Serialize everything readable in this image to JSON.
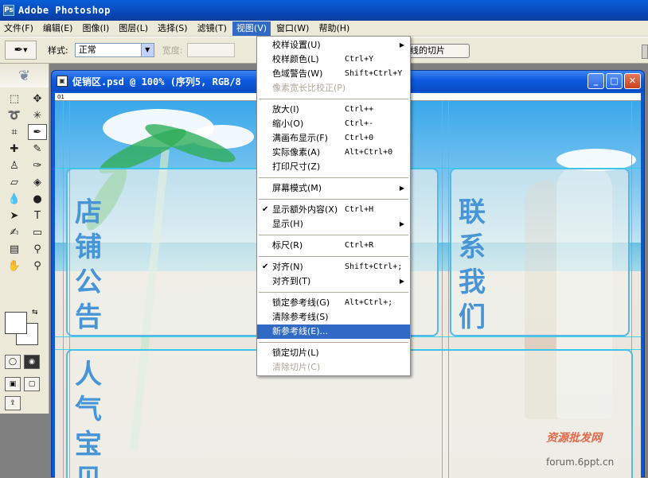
{
  "app": {
    "title": "Adobe Photoshop"
  },
  "menubar": [
    {
      "label": "文件(F)"
    },
    {
      "label": "编辑(E)"
    },
    {
      "label": "图像(I)"
    },
    {
      "label": "图层(L)"
    },
    {
      "label": "选择(S)"
    },
    {
      "label": "滤镜(T)"
    },
    {
      "label": "视图(V)"
    },
    {
      "label": "窗口(W)"
    },
    {
      "label": "帮助(H)"
    }
  ],
  "options": {
    "style_label": "样式:",
    "style_value": "正常",
    "width_label": "宽度:",
    "slice_button": "线的切片"
  },
  "document": {
    "title": "促销区.psd @ 100% (序列5, RGB/8",
    "ruler_label": "01"
  },
  "panels": {
    "notice": "店铺公告",
    "contact": "联系我们",
    "popular": "人气宝贝"
  },
  "view_menu": {
    "groups": [
      [
        {
          "label": "校样设置(U)",
          "shortcut": "",
          "submenu": true
        },
        {
          "label": "校样颜色(L)",
          "shortcut": "Ctrl+Y"
        },
        {
          "label": "色域警告(W)",
          "shortcut": "Shift+Ctrl+Y"
        },
        {
          "label": "像素宽长比校正(P)",
          "shortcut": "",
          "disabled": true
        }
      ],
      [
        {
          "label": "放大(I)",
          "shortcut": "Ctrl++"
        },
        {
          "label": "缩小(O)",
          "shortcut": "Ctrl+-"
        },
        {
          "label": "满画布显示(F)",
          "shortcut": "Ctrl+0"
        },
        {
          "label": "实际像素(A)",
          "shortcut": "Alt+Ctrl+0"
        },
        {
          "label": "打印尺寸(Z)",
          "shortcut": ""
        }
      ],
      [
        {
          "label": "屏幕模式(M)",
          "shortcut": "",
          "submenu": true
        }
      ],
      [
        {
          "label": "显示额外内容(X)",
          "shortcut": "Ctrl+H",
          "checked": true
        },
        {
          "label": "显示(H)",
          "shortcut": "",
          "submenu": true
        }
      ],
      [
        {
          "label": "标尺(R)",
          "shortcut": "Ctrl+R"
        }
      ],
      [
        {
          "label": "对齐(N)",
          "shortcut": "Shift+Ctrl+;",
          "checked": true
        },
        {
          "label": "对齐到(T)",
          "shortcut": "",
          "submenu": true
        }
      ],
      [
        {
          "label": "锁定参考线(G)",
          "shortcut": "Alt+Ctrl+;"
        },
        {
          "label": "清除参考线(S)",
          "shortcut": ""
        },
        {
          "label": "新参考线(E)...",
          "shortcut": "",
          "highlighted": true
        }
      ],
      [
        {
          "label": "锁定切片(L)",
          "shortcut": ""
        },
        {
          "label": "清除切片(C)",
          "shortcut": "",
          "disabled": true
        }
      ]
    ]
  },
  "watermark": {
    "line1": "资源批发网",
    "line2": "forum.6ppt.cn"
  },
  "colors": {
    "menu_highlight": "#316ac5",
    "panel_text": "#4795d6",
    "guide": "#22d3e8"
  }
}
